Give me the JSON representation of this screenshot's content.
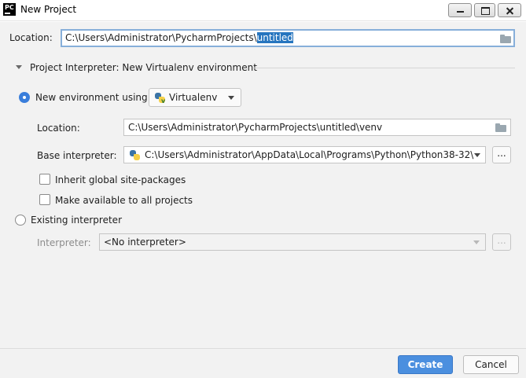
{
  "window": {
    "title": "New Project",
    "app_icon_text": "PC"
  },
  "location": {
    "label": "Location:",
    "path_prefix": "C:\\Users\\Administrator\\PycharmProjects\\",
    "path_selected": "untitled"
  },
  "interpreter_section": {
    "header": "Project Interpreter: New Virtualenv environment",
    "new_env": {
      "radio_label": "New environment using",
      "tool_value": "Virtualenv",
      "location_label": "Location:",
      "location_value": "C:\\Users\\Administrator\\PycharmProjects\\untitled\\venv",
      "base_label": "Base interpreter:",
      "base_value": "C:\\Users\\Administrator\\AppData\\Local\\Programs\\Python\\Python38-32\\",
      "browse_label": "...",
      "inherit_label": "Inherit global site-packages",
      "make_available_label": "Make available to all projects"
    },
    "existing": {
      "radio_label": "Existing interpreter",
      "interpreter_label": "Interpreter:",
      "interpreter_value": "<No interpreter>",
      "browse_label": "..."
    }
  },
  "footer": {
    "create_label": "Create",
    "cancel_label": "Cancel"
  },
  "colors": {
    "accent": "#4b8fdf",
    "selection": "#2675bf",
    "focus_border": "#87afda"
  }
}
